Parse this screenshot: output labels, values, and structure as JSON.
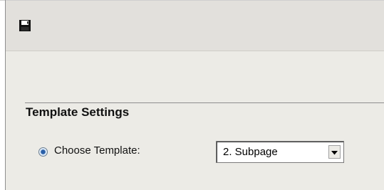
{
  "toolbar": {
    "save_icon": "floppy-disk-icon"
  },
  "settings": {
    "section_title": "Template Settings",
    "choose_template_label": "Choose Template:",
    "template_select": {
      "selected_value": "2. Subpage",
      "icon": "chevron-down-icon"
    }
  }
}
